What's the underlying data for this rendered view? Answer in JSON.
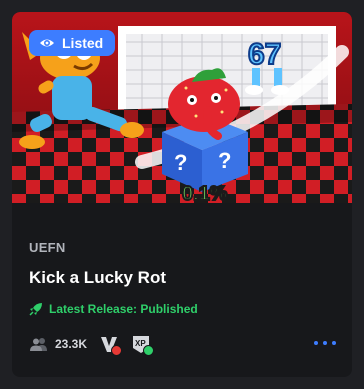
{
  "card": {
    "badge_label": "Listed",
    "eyebrow": "UEFN",
    "title": "Kick a Lucky Rot",
    "release_status": "Latest Release: Published",
    "player_count": "23.3K",
    "thumbnail": {
      "label_top": "67",
      "label_bottom": "0.1%"
    },
    "colors": {
      "accent": "#3d7dff",
      "status_green": "#2fcf6a",
      "badge_error": "#e53935"
    },
    "icons": [
      "eye-icon",
      "rocket-icon",
      "players-icon",
      "v-badge-icon",
      "xp-badge-icon",
      "more-options-icon"
    ]
  }
}
